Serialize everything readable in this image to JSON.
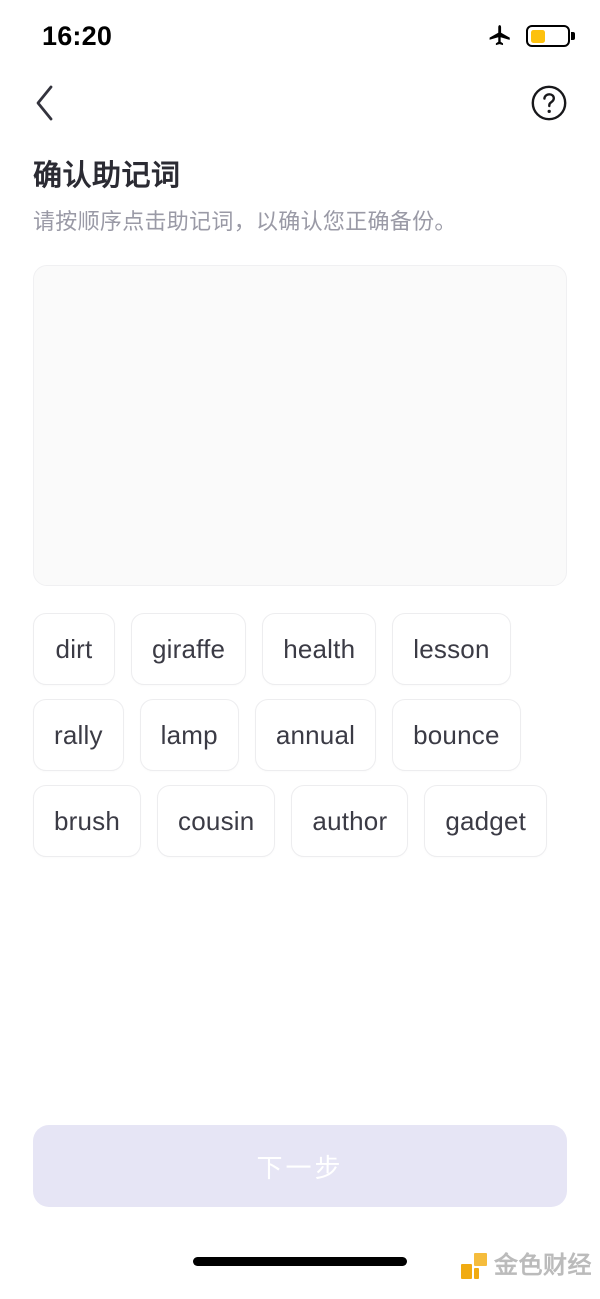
{
  "status_bar": {
    "time": "16:20",
    "airplane_icon": "airplane-mode-icon",
    "battery_icon": "battery-icon",
    "battery_level_percent": 42,
    "battery_color": "#FDC10E"
  },
  "nav": {
    "back_icon": "chevron-left-icon",
    "help_icon": "question-mark-circle-icon"
  },
  "header": {
    "title": "确认助记词",
    "subtitle": "请按顺序点击助记词，以确认您正确备份。"
  },
  "dropzone": {
    "selected_words": [],
    "background_color": "#FAFAFA"
  },
  "word_bank": {
    "words": [
      "dirt",
      "giraffe",
      "health",
      "lesson",
      "rally",
      "lamp",
      "annual",
      "bounce",
      "brush",
      "cousin",
      "author",
      "gadget"
    ]
  },
  "footer": {
    "next_button_label": "下一步",
    "next_button_enabled": false,
    "next_button_color": "#E6E5F5"
  },
  "watermark": {
    "text": "金色财经",
    "logo_icon": "jinse-logo-icon",
    "accent_color": "#F0A500"
  },
  "home_indicator": "home-indicator-bar"
}
